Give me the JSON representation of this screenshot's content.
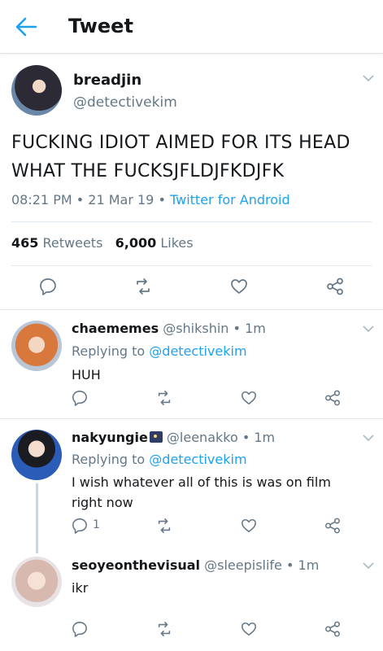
{
  "header": {
    "title": "Tweet",
    "back_icon": "arrow-left-icon",
    "accent": "#1da1f2"
  },
  "main_tweet": {
    "display_name": "breadjin",
    "handle": "@detectivekim",
    "text": "FUCKING IDIOT AIMED FOR ITS HEAD WHAT THE FUCKSJFLDJFKDJFK",
    "time": "08:21 PM",
    "date": "21 Mar 19",
    "source": "Twitter for Android",
    "retweets_count": "465",
    "retweets_label": "Retweets",
    "likes_count": "6,000",
    "likes_label": "Likes"
  },
  "replies": [
    {
      "display_name": "chaememes",
      "handle": "@shikshin",
      "time": "1m",
      "replying_label": "Replying to",
      "replying_to": "@detectivekim",
      "text": "HUH",
      "reply_count": ""
    },
    {
      "display_name": "nakyungie",
      "handle": "@leenakko",
      "time": "1m",
      "replying_label": "Replying to",
      "replying_to": "@detectivekim",
      "text": "I wish whatever all of this is was on film right now",
      "reply_count": "1"
    },
    {
      "display_name": "seoyeonthevisual",
      "handle": "@sleepislife",
      "time": "1m",
      "text": "ikr",
      "reply_count": ""
    }
  ],
  "separator": "•"
}
